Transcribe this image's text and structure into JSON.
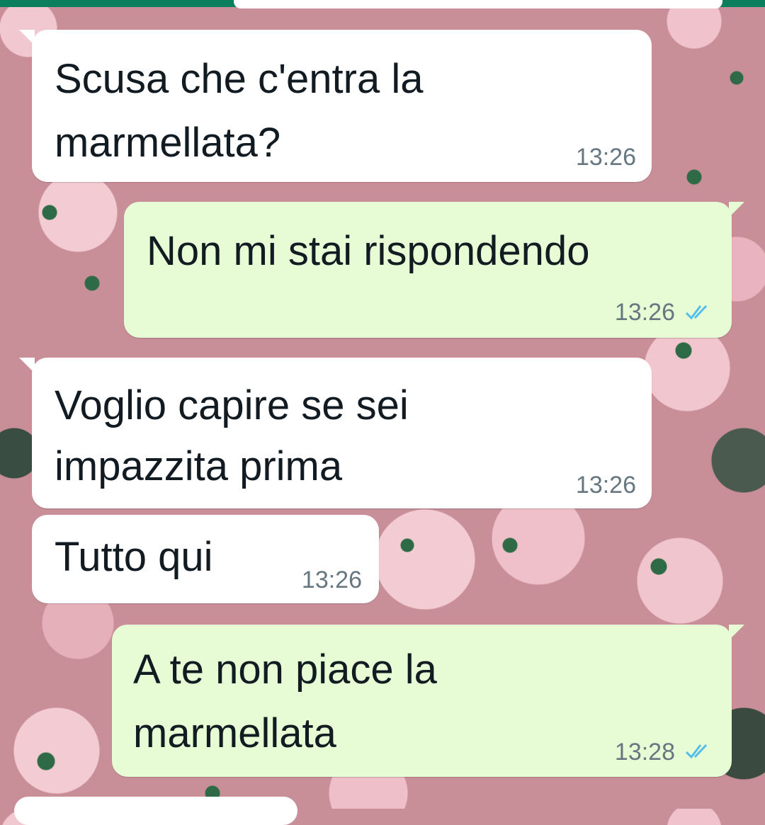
{
  "messages": [
    {
      "direction": "incoming",
      "text_lines": [
        "Scusa che c'entra la",
        "marmellata?"
      ],
      "time": "13:26"
    },
    {
      "direction": "outgoing",
      "text_lines": [
        "Non mi stai rispondendo"
      ],
      "time": "13:26",
      "status_icon": "double-check-read-icon"
    },
    {
      "direction": "incoming",
      "text_lines": [
        "Voglio capire se sei",
        "impazzita prima"
      ],
      "time": "13:26"
    },
    {
      "direction": "incoming",
      "text_lines": [
        "Tutto qui"
      ],
      "time": "13:26"
    },
    {
      "direction": "outgoing",
      "text_lines": [
        "A te non piace la",
        "marmellata"
      ],
      "time": "13:28",
      "status_icon": "double-check-read-icon"
    }
  ],
  "colors": {
    "incoming_bubble": "#ffffff",
    "outgoing_bubble": "#e7fcd4",
    "read_ticks": "#53bdeb",
    "header": "#0b7e5e"
  }
}
